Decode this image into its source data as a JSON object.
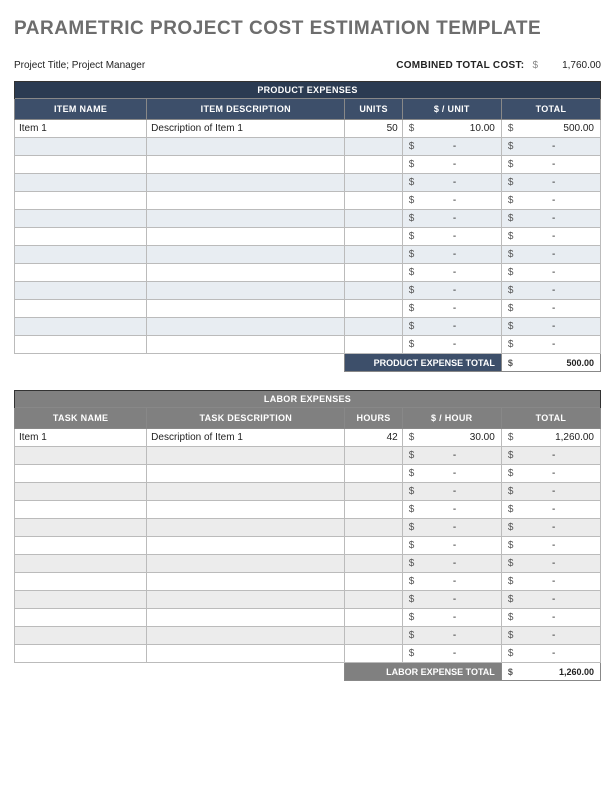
{
  "title": "PARAMETRIC PROJECT COST ESTIMATION TEMPLATE",
  "meta": {
    "project_line": "Project Title; Project Manager",
    "combined_label": "COMBINED TOTAL COST:",
    "currency": "$",
    "combined_total": "1,760.00"
  },
  "product": {
    "section_title": "PRODUCT EXPENSES",
    "cols": {
      "name": "ITEM NAME",
      "desc": "ITEM DESCRIPTION",
      "units": "UNITS",
      "rate": "$ / UNIT",
      "total": "TOTAL"
    },
    "rows": [
      {
        "name": "Item 1",
        "desc": "Description of Item 1",
        "units": "50",
        "rate": "10.00",
        "total": "500.00"
      },
      {},
      {},
      {},
      {},
      {},
      {},
      {},
      {},
      {},
      {},
      {},
      {}
    ],
    "subtotal_label": "PRODUCT EXPENSE TOTAL",
    "subtotal": "500.00"
  },
  "labor": {
    "section_title": "LABOR EXPENSES",
    "cols": {
      "name": "TASK NAME",
      "desc": "TASK DESCRIPTION",
      "units": "HOURS",
      "rate": "$ / HOUR",
      "total": "TOTAL"
    },
    "rows": [
      {
        "name": "Item 1",
        "desc": "Description of Item 1",
        "units": "42",
        "rate": "30.00",
        "total": "1,260.00"
      },
      {},
      {},
      {},
      {},
      {},
      {},
      {},
      {},
      {},
      {},
      {},
      {}
    ],
    "subtotal_label": "LABOR EXPENSE TOTAL",
    "subtotal": "1,260.00"
  },
  "currency": "$",
  "dash": "-"
}
